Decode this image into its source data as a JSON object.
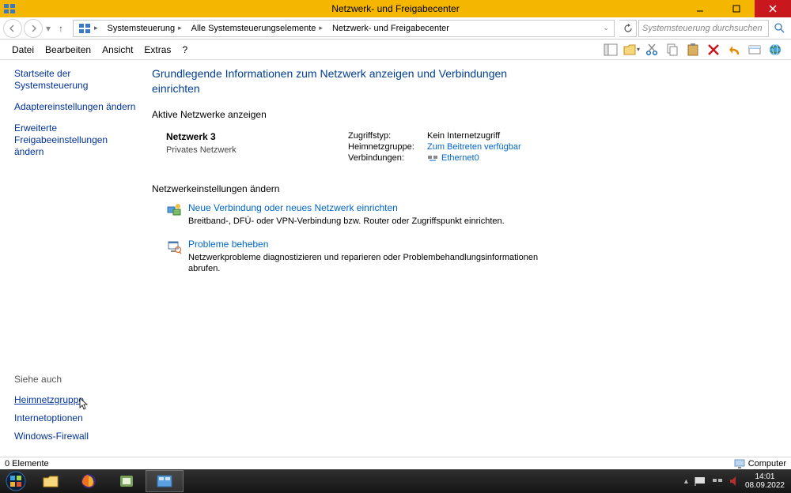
{
  "window": {
    "title": "Netzwerk- und Freigabecenter"
  },
  "breadcrumb": {
    "items": [
      "Systemsteuerung",
      "Alle Systemsteuerungselemente",
      "Netzwerk- und Freigabecenter"
    ]
  },
  "search": {
    "placeholder": "Systemsteuerung durchsuchen"
  },
  "menu": {
    "file": "Datei",
    "edit": "Bearbeiten",
    "view": "Ansicht",
    "extras": "Extras",
    "help": "?"
  },
  "sidebar": {
    "home": "Startseite der Systemsteuerung",
    "adapter": "Adaptereinstellungen ändern",
    "sharing": "Erweiterte Freigabeeinstellungen ändern",
    "seealso_label": "Siehe auch",
    "seealso": {
      "homegroup": "Heimnetzgruppe",
      "internet": "Internetoptionen",
      "firewall": "Windows-Firewall"
    }
  },
  "content": {
    "heading": "Grundlegende Informationen zum Netzwerk anzeigen und Verbindungen einrichten",
    "active_label": "Aktive Netzwerke anzeigen",
    "network": {
      "name": "Netzwerk  3",
      "type": "Privates Netzwerk",
      "access_label": "Zugriffstyp:",
      "access_value": "Kein Internetzugriff",
      "homegroup_label": "Heimnetzgruppe:",
      "homegroup_value": "Zum Beitreten verfügbar",
      "connections_label": "Verbindungen:",
      "connections_value": "Ethernet0"
    },
    "settings_label": "Netzwerkeinstellungen ändern",
    "action1": {
      "title": "Neue Verbindung oder neues Netzwerk einrichten",
      "desc": "Breitband-, DFÜ- oder VPN-Verbindung bzw. Router oder Zugriffspunkt einrichten."
    },
    "action2": {
      "title": "Probleme beheben",
      "desc": "Netzwerkprobleme diagnostizieren und reparieren oder Problembehandlungsinformationen abrufen."
    }
  },
  "statusbar": {
    "left": "0 Elemente",
    "right": "Computer"
  },
  "tray": {
    "time": "14:01",
    "date": "08.09.2022"
  }
}
